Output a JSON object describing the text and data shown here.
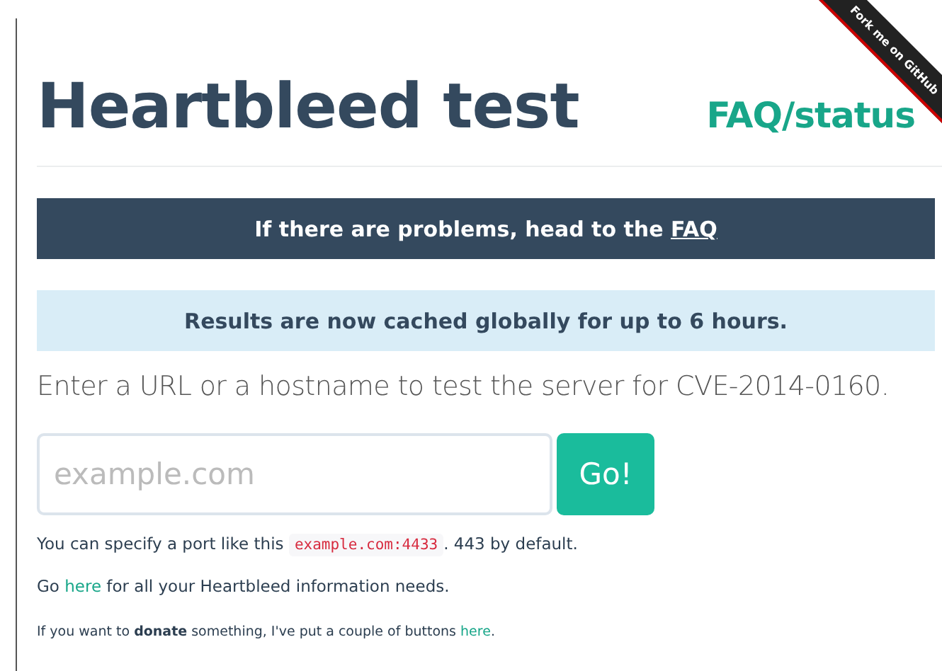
{
  "ribbon": "Fork me on GitHub",
  "title": "Heartbleed test",
  "faq_link": "FAQ/status",
  "alert_banner": {
    "before": "If there are problems, head to the ",
    "link": "FAQ"
  },
  "info_banner": "Results are now cached globally for up to 6 hours.",
  "lead": "Enter a URL or a hostname to test the server for CVE-2014-0160.",
  "search": {
    "placeholder": "example.com",
    "button": "Go!"
  },
  "port_note": {
    "before": "You can specify a port like this ",
    "code": "example.com:4433",
    "after": ". 443 by default."
  },
  "info_note": {
    "before": "Go ",
    "link": "here",
    "after": " for all your Heartbleed information needs."
  },
  "donate_note": {
    "before": "If you want to **donate** something, I've put a couple of buttons ",
    "link": "here",
    "after": "."
  }
}
